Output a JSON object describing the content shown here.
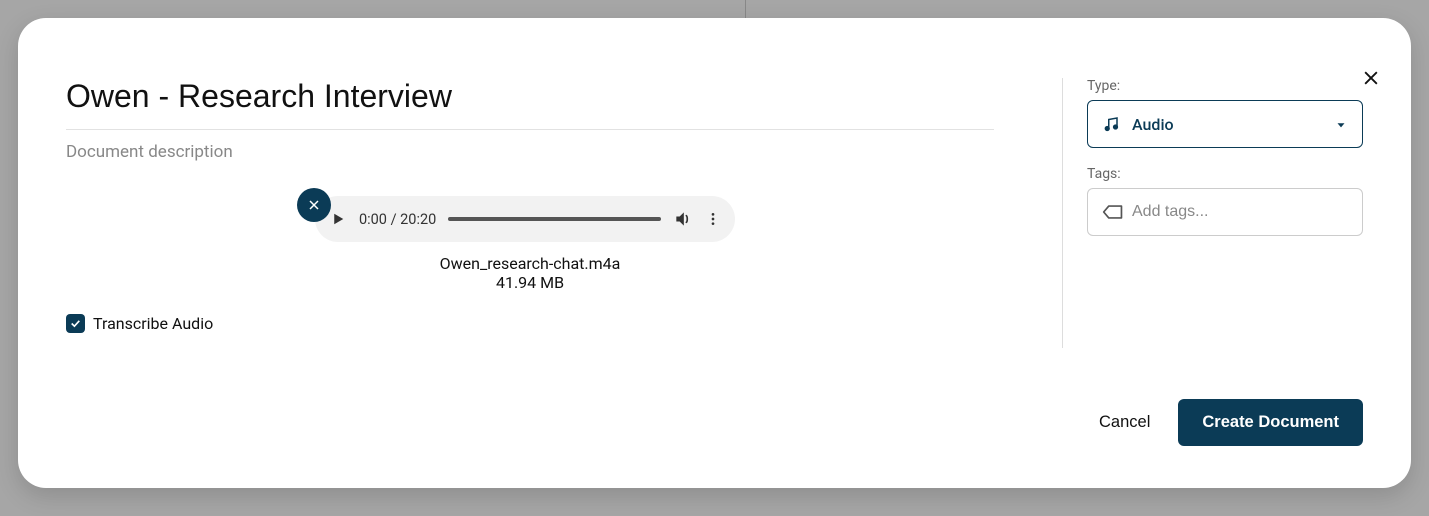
{
  "title": "Owen - Research Interview",
  "description_placeholder": "Document description",
  "audio": {
    "current_time": "0:00",
    "duration": "20:20",
    "file_name": "Owen_research-chat.m4a",
    "file_size": "41.94 MB"
  },
  "transcribe": {
    "label": "Transcribe Audio",
    "checked": true
  },
  "sidebar": {
    "type_label": "Type:",
    "type_value": "Audio",
    "tags_label": "Tags:",
    "tags_placeholder": "Add tags..."
  },
  "buttons": {
    "cancel": "Cancel",
    "create": "Create Document"
  }
}
